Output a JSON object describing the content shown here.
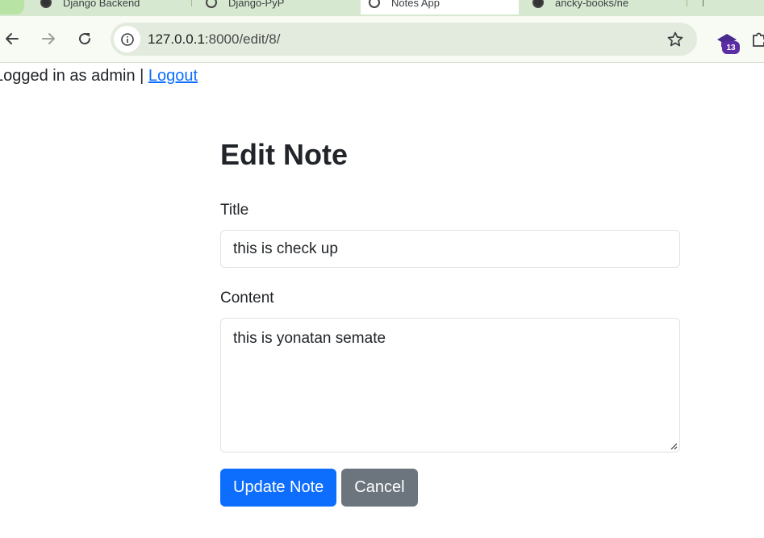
{
  "browser": {
    "tabs": [
      {
        "label": "Django Backend"
      },
      {
        "label": "Django-PyP"
      },
      {
        "label": "Notes App"
      },
      {
        "label": "ancky-books/ne"
      }
    ],
    "address_bar": {
      "host": "127.0.0.1",
      "path": ":8000/edit/8/"
    },
    "extension_badge": "13",
    "icons": [
      "back-icon",
      "forward-icon",
      "reload-icon",
      "site-info-icon",
      "bookmark-star-icon",
      "extension-icon",
      "puzzle-icon"
    ]
  },
  "userbar": {
    "status": "Logged in as admin |",
    "logout_label": "Logout"
  },
  "form": {
    "heading": "Edit Note",
    "title_label": "Title",
    "title_value": "this is check up",
    "content_label": "Content",
    "content_value": "this is yonatan semate",
    "update_label": "Update Note",
    "cancel_label": "Cancel"
  },
  "colors": {
    "primary": "#0d6efd",
    "secondary": "#6c757d",
    "chrome_green": "#d6e8cf",
    "badge": "#5b2fa3"
  }
}
